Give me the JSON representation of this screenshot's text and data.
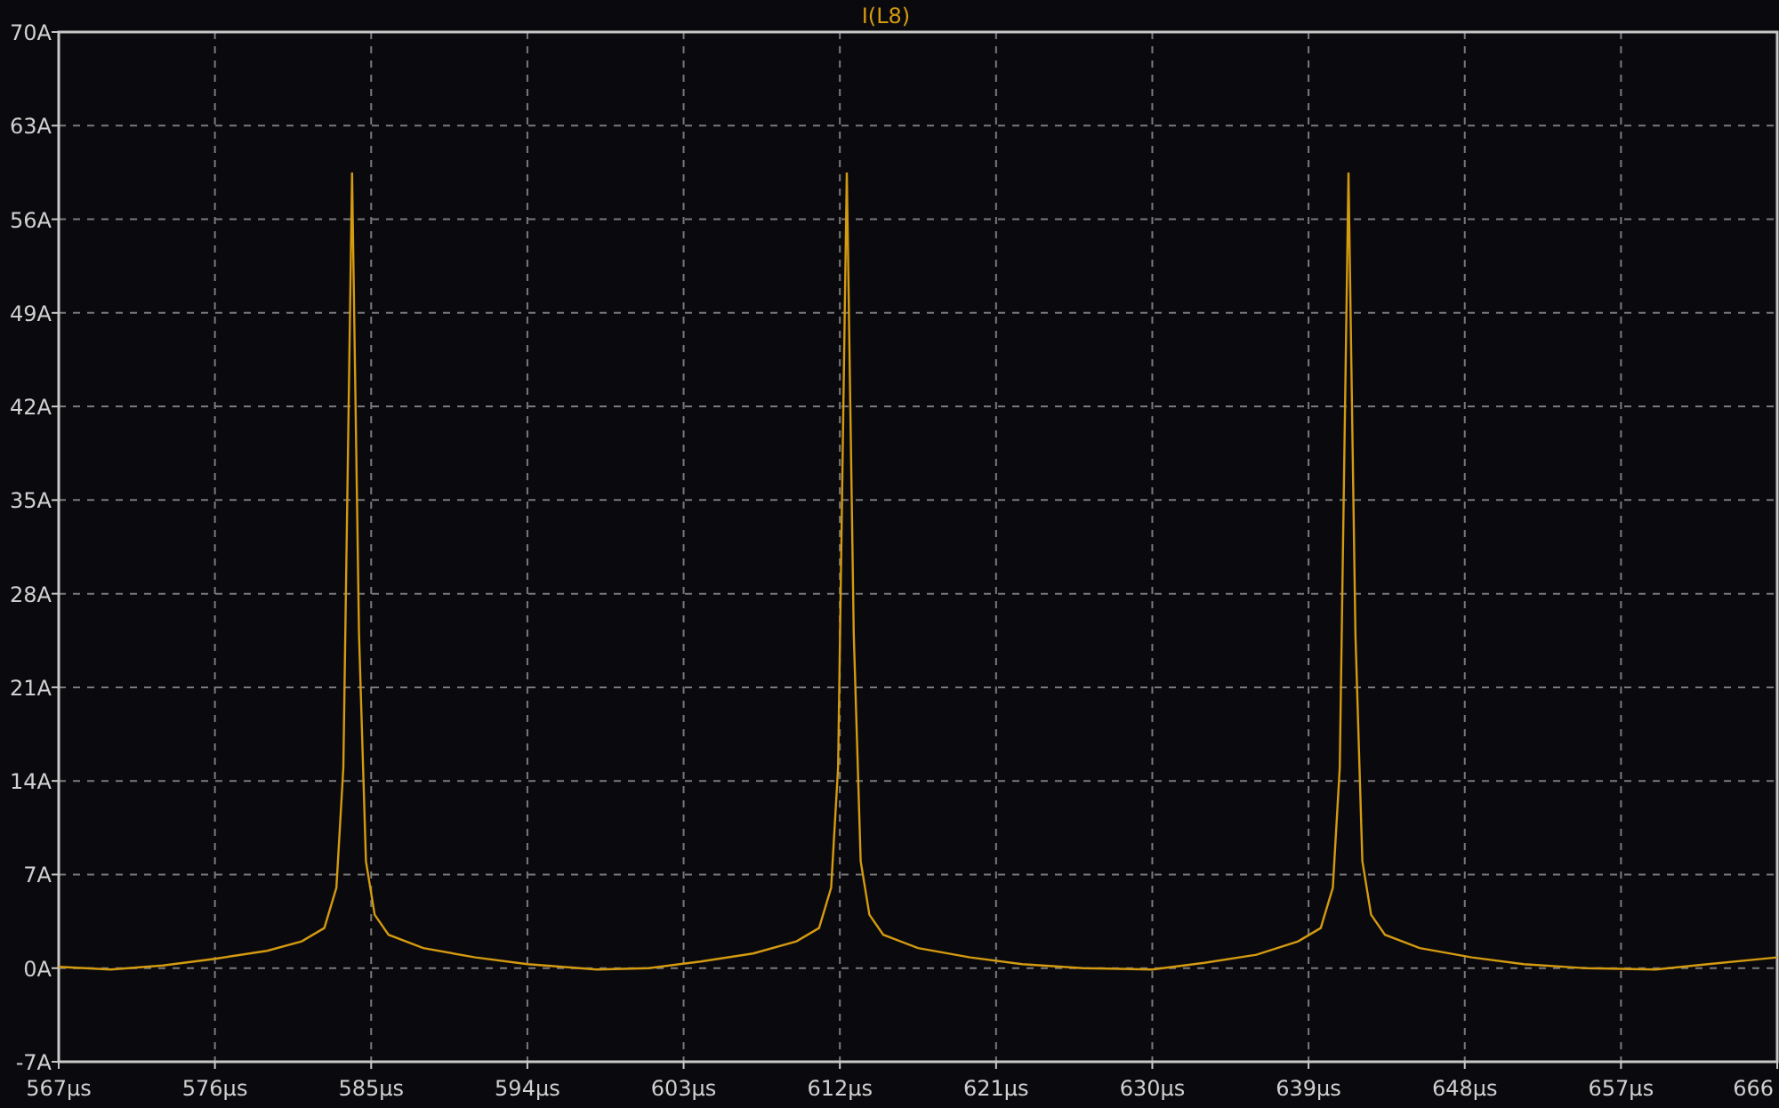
{
  "chart_data": {
    "type": "line",
    "grid": true,
    "x": [
      567,
      570,
      573,
      576,
      579,
      581,
      582.3,
      583,
      583.4,
      583.9,
      584.3,
      584.7,
      585.2,
      586,
      588,
      591,
      594,
      598,
      601,
      604,
      607,
      609.5,
      610.8,
      611.5,
      611.9,
      612.4,
      612.8,
      613.2,
      613.7,
      614.5,
      616.5,
      619.5,
      622.5,
      626,
      630,
      633,
      636,
      638.4,
      639.7,
      640.4,
      640.8,
      641.3,
      641.7,
      642.1,
      642.6,
      643.4,
      645.4,
      648.4,
      651.4,
      655,
      659,
      662,
      666
    ],
    "series": [
      {
        "name": "I(L8)",
        "color": "#d49a10",
        "values": [
          0.1,
          -0.1,
          0.2,
          0.7,
          1.3,
          2,
          3,
          6,
          15,
          59.5,
          25,
          8,
          4,
          2.5,
          1.5,
          0.8,
          0.3,
          -0.1,
          0,
          0.5,
          1.1,
          2,
          3,
          6,
          15,
          59.5,
          25,
          8,
          4,
          2.5,
          1.5,
          0.8,
          0.3,
          0,
          -0.1,
          0.4,
          1,
          2,
          3,
          6,
          15,
          59.5,
          25,
          8,
          4,
          2.5,
          1.5,
          0.8,
          0.3,
          0,
          -0.1,
          0.3,
          0.8
        ]
      }
    ],
    "xlim": [
      567,
      666
    ],
    "ylim": [
      -7,
      70
    ],
    "xticks": [
      {
        "value": 567,
        "label": "567µs"
      },
      {
        "value": 576,
        "label": "576µs"
      },
      {
        "value": 585,
        "label": "585µs"
      },
      {
        "value": 594,
        "label": "594µs"
      },
      {
        "value": 603,
        "label": "603µs"
      },
      {
        "value": 612,
        "label": "612µs"
      },
      {
        "value": 621,
        "label": "621µs"
      },
      {
        "value": 630,
        "label": "630µs"
      },
      {
        "value": 639,
        "label": "639µs"
      },
      {
        "value": 648,
        "label": "648µs"
      },
      {
        "value": 657,
        "label": "657µs"
      },
      {
        "value": 666,
        "label": "666"
      }
    ],
    "yticks": [
      {
        "value": 70,
        "label": "70A"
      },
      {
        "value": 63,
        "label": "63A"
      },
      {
        "value": 56,
        "label": "56A"
      },
      {
        "value": 49,
        "label": "49A"
      },
      {
        "value": 42,
        "label": "42A"
      },
      {
        "value": 35,
        "label": "35A"
      },
      {
        "value": 28,
        "label": "28A"
      },
      {
        "value": 21,
        "label": "21A"
      },
      {
        "value": 14,
        "label": "14A"
      },
      {
        "value": 7,
        "label": "7A"
      },
      {
        "value": 0,
        "label": "0A"
      },
      {
        "value": -7,
        "label": "-7A"
      }
    ]
  }
}
